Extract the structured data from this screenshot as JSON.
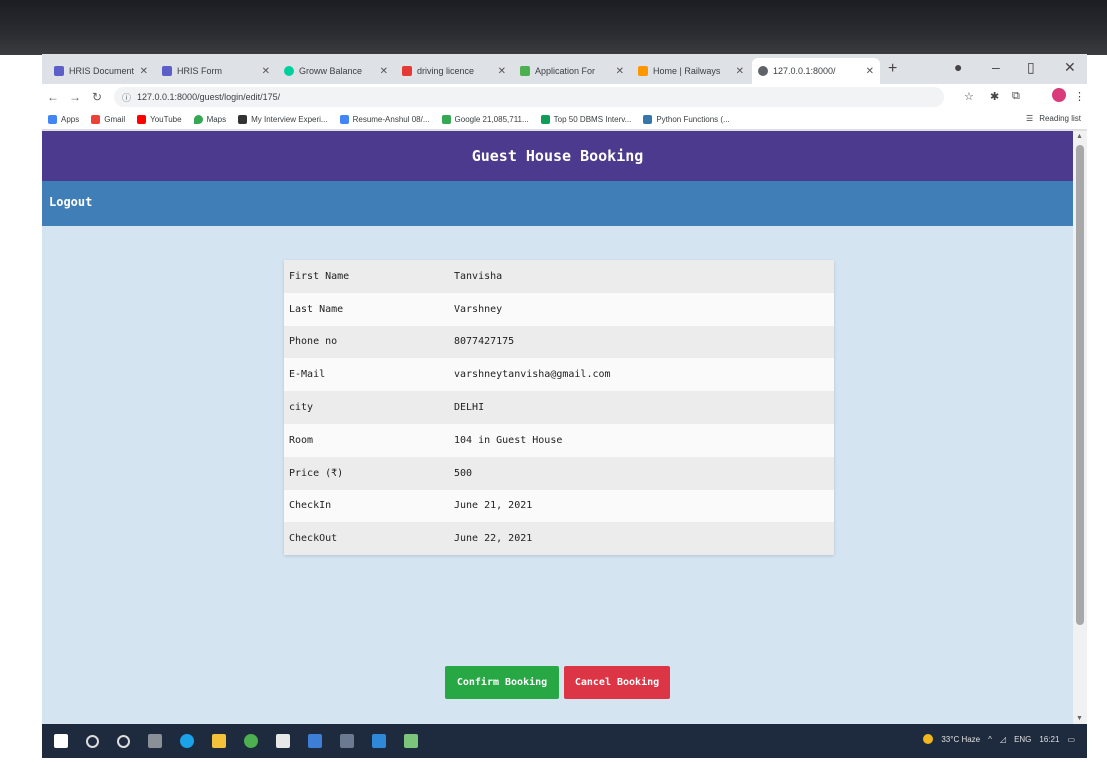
{
  "browser": {
    "tabs": [
      {
        "label": "HRIS Document",
        "favicon_color": "#5b5fc7"
      },
      {
        "label": "HRIS Form",
        "favicon_color": "#5b5fc7"
      },
      {
        "label": "Groww Balance",
        "favicon_color": "#00d09c"
      },
      {
        "label": "driving licence",
        "favicon_color": "#e53935"
      },
      {
        "label": "Application For",
        "favicon_color": "#4caf50"
      },
      {
        "label": "Home | Railways",
        "favicon_color": "#ff9800"
      },
      {
        "label": "127.0.0.1:8000/",
        "favicon_color": "#5f6368",
        "active": true
      }
    ],
    "url": "127.0.0.1:8000/guest/login/edit/175/",
    "bookmarks": [
      {
        "label": "Apps",
        "icon_color": "#4285f4"
      },
      {
        "label": "Gmail",
        "icon_color": "#ea4335"
      },
      {
        "label": "YouTube",
        "icon_color": "#ff0000"
      },
      {
        "label": "Maps",
        "icon_color": "#34a853"
      },
      {
        "label": "My Interview Experi...",
        "icon_color": "#333333"
      },
      {
        "label": "Resume-Anshul 08/...",
        "icon_color": "#4285f4"
      },
      {
        "label": "Google 21,085,711...",
        "icon_color": "#34a853"
      },
      {
        "label": "Top 50 DBMS Interv...",
        "icon_color": "#0f9d58"
      },
      {
        "label": "Python Functions (...",
        "icon_color": "#3776ab"
      }
    ],
    "reading_list": "Reading list"
  },
  "page": {
    "title": "Guest House Booking",
    "logout_label": "Logout",
    "details": [
      {
        "label": "First Name",
        "value": "Tanvisha"
      },
      {
        "label": "Last Name",
        "value": "Varshney"
      },
      {
        "label": "Phone no",
        "value": "8077427175"
      },
      {
        "label": "E-Mail",
        "value": "varshneytanvisha@gmail.com"
      },
      {
        "label": "city",
        "value": "DELHI"
      },
      {
        "label": "Room",
        "value": "104 in Guest House"
      },
      {
        "label": "Price (₹)",
        "value": "500"
      },
      {
        "label": "CheckIn",
        "value": "June 21, 2021"
      },
      {
        "label": "CheckOut",
        "value": "June 22, 2021"
      }
    ],
    "confirm_label": "Confirm Booking",
    "cancel_label": "Cancel Booking"
  },
  "colors": {
    "header": "#4b3a8d",
    "navbar": "#3f7eb7",
    "page_bg": "#d4e4f1",
    "confirm": "#28a745",
    "cancel": "#dc3545"
  },
  "taskbar": {
    "weather": "33°C Haze",
    "language": "ENG",
    "time": "16:21"
  }
}
